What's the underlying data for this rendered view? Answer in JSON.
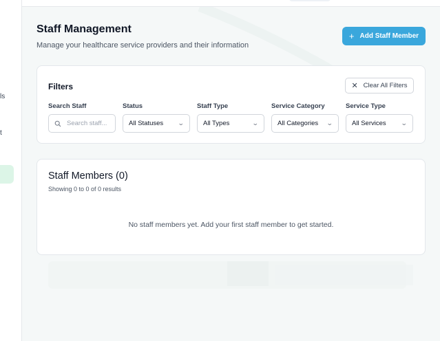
{
  "sidebar": {
    "fragments": [
      "ls",
      "t"
    ]
  },
  "header": {
    "title": "Staff Management",
    "subtitle": "Manage your healthcare service providers and their information",
    "add_button": {
      "icon": "plus-icon",
      "label": "Add Staff Member"
    }
  },
  "filters": {
    "title": "Filters",
    "clear_button": {
      "icon": "close-icon",
      "label": "Clear All Filters"
    },
    "search": {
      "label": "Search Staff",
      "placeholder": "Search staff..."
    },
    "status": {
      "label": "Status",
      "value": "All Statuses"
    },
    "staff_type": {
      "label": "Staff Type",
      "value": "All Types"
    },
    "service_category": {
      "label": "Service Category",
      "value": "All Categories"
    },
    "service_type": {
      "label": "Service Type",
      "value": "All Services"
    }
  },
  "staff_list": {
    "title": "Staff Members (0)",
    "count_text": "Showing 0 to 0 of 0 results",
    "empty_message": "No staff members yet. Add your first staff member to get started."
  },
  "colors": {
    "accent": "#3aa7dc",
    "active_nav": "#dcf5e7",
    "background": "#f5f8f8"
  }
}
